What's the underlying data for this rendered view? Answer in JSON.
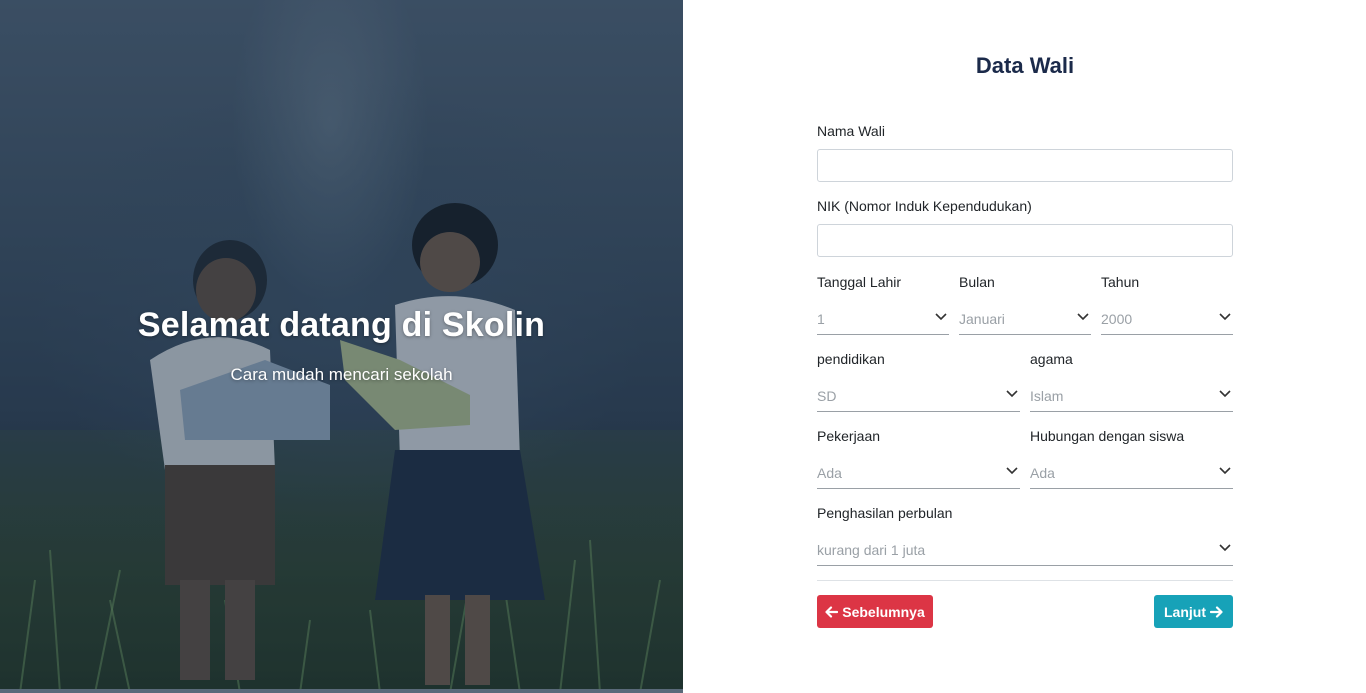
{
  "hero": {
    "title": "Selamat datang di Skolin",
    "subtitle": "Cara mudah mencari sekolah"
  },
  "form": {
    "title": "Data Wali",
    "nama_wali": {
      "label": "Nama Wali",
      "value": ""
    },
    "nik": {
      "label": "NIK (Nomor Induk Kependudukan)",
      "value": ""
    },
    "tanggal_lahir": {
      "label": "Tanggal Lahir",
      "value": "1"
    },
    "bulan": {
      "label": "Bulan",
      "value": "Januari"
    },
    "tahun": {
      "label": "Tahun",
      "value": "2000"
    },
    "pendidikan": {
      "label": "pendidikan",
      "value": "SD"
    },
    "agama": {
      "label": "agama",
      "value": "Islam"
    },
    "pekerjaan": {
      "label": "Pekerjaan",
      "value": "Ada"
    },
    "hubungan": {
      "label": "Hubungan dengan siswa",
      "value": "Ada"
    },
    "penghasilan": {
      "label": "Penghasilan perbulan",
      "value": "kurang dari 1 juta"
    }
  },
  "buttons": {
    "prev_label": "Sebelumnya",
    "next_label": "Lanjut"
  },
  "icons": {
    "prev": "arrow-left-icon",
    "next": "arrow-right-icon",
    "select": "chevron-down-icon"
  },
  "colors": {
    "title": "#1b2a4a",
    "prev_button": "#dc3545",
    "next_button": "#17a2b8"
  }
}
